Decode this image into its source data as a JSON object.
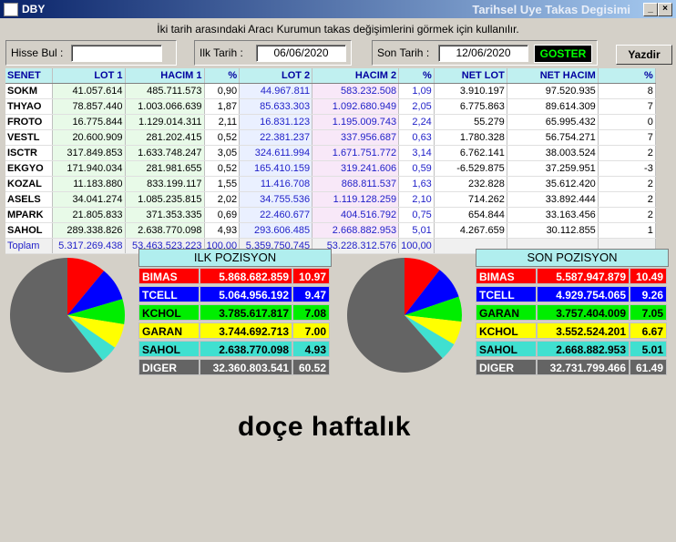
{
  "window": {
    "title": "DBY",
    "right_title": "Tarihsel Uye Takas Degisimi"
  },
  "hint": "İki tarih arasındaki  Aracı Kurumun takas değişimlerini görmek için kullanılır.",
  "form": {
    "hisse_label": "Hisse Bul :",
    "hisse_value": "",
    "ilk_label": "Ilk Tarih :",
    "ilk_value": "06/06/2020",
    "son_label": "Son Tarih :",
    "son_value": "12/06/2020",
    "goster": "GOSTER",
    "yazdir": "Yazdir"
  },
  "table": {
    "headers": [
      "SENET",
      "LOT 1",
      "HACIM 1",
      "%",
      "LOT 2",
      "HACIM 2",
      "%",
      "NET LOT",
      "NET HACIM",
      "%"
    ],
    "rows": [
      [
        "SOKM",
        "41.057.614",
        "485.711.573",
        "0,90",
        "44.967.811",
        "583.232.508",
        "1,09",
        "3.910.197",
        "97.520.935",
        "8"
      ],
      [
        "THYAO",
        "78.857.440",
        "1.003.066.639",
        "1,87",
        "85.633.303",
        "1.092.680.949",
        "2,05",
        "6.775.863",
        "89.614.309",
        "7"
      ],
      [
        "FROTO",
        "16.775.844",
        "1.129.014.311",
        "2,11",
        "16.831.123",
        "1.195.009.743",
        "2,24",
        "55.279",
        "65.995.432",
        "0"
      ],
      [
        "VESTL",
        "20.600.909",
        "281.202.415",
        "0,52",
        "22.381.237",
        "337.956.687",
        "0,63",
        "1.780.328",
        "56.754.271",
        "7"
      ],
      [
        "ISCTR",
        "317.849.853",
        "1.633.748.247",
        "3,05",
        "324.611.994",
        "1.671.751.772",
        "3,14",
        "6.762.141",
        "38.003.524",
        "2"
      ],
      [
        "EKGYO",
        "171.940.034",
        "281.981.655",
        "0,52",
        "165.410.159",
        "319.241.606",
        "0,59",
        "-6.529.875",
        "37.259.951",
        "-3"
      ],
      [
        "KOZAL",
        "11.183.880",
        "833.199.117",
        "1,55",
        "11.416.708",
        "868.811.537",
        "1,63",
        "232.828",
        "35.612.420",
        "2"
      ],
      [
        "ASELS",
        "34.041.274",
        "1.085.235.815",
        "2,02",
        "34.755.536",
        "1.119.128.259",
        "2,10",
        "714.262",
        "33.892.444",
        "2"
      ],
      [
        "MPARK",
        "21.805.833",
        "371.353.335",
        "0,69",
        "22.460.677",
        "404.516.792",
        "0,75",
        "654.844",
        "33.163.456",
        "2"
      ],
      [
        "SAHOL",
        "289.338.826",
        "2.638.770.098",
        "4,93",
        "293.606.485",
        "2.668.882.953",
        "5,01",
        "4.267.659",
        "30.112.855",
        "1"
      ]
    ],
    "total": [
      "Toplam",
      "5.317.269.438",
      "53.463.523.223",
      "100,00",
      "5.359.750.745",
      "53.228.312.576",
      "100,00",
      "",
      "",
      ""
    ]
  },
  "ilk_pozisyon": {
    "title": "ILK POZISYON",
    "rows": [
      {
        "name": "BIMAS",
        "value": "5.868.682.859",
        "pct": "10.97",
        "color": "#ff0000"
      },
      {
        "name": "TCELL",
        "value": "5.064.956.192",
        "pct": "9.47",
        "color": "#0000ff"
      },
      {
        "name": "KCHOL",
        "value": "3.785.617.817",
        "pct": "7.08",
        "color": "#00ee00"
      },
      {
        "name": "GARAN",
        "value": "3.744.692.713",
        "pct": "7.00",
        "color": "#ffff00"
      },
      {
        "name": "SAHOL",
        "value": "2.638.770.098",
        "pct": "4.93",
        "color": "#40e0d0"
      },
      {
        "name": "DIGER",
        "value": "32.360.803.541",
        "pct": "60.52",
        "color": "#646464"
      }
    ]
  },
  "son_pozisyon": {
    "title": "SON POZISYON",
    "rows": [
      {
        "name": "BIMAS",
        "value": "5.587.947.879",
        "pct": "10.49",
        "color": "#ff0000"
      },
      {
        "name": "TCELL",
        "value": "4.929.754.065",
        "pct": "9.26",
        "color": "#0000ff"
      },
      {
        "name": "GARAN",
        "value": "3.757.404.009",
        "pct": "7.05",
        "color": "#00ee00"
      },
      {
        "name": "KCHOL",
        "value": "3.552.524.201",
        "pct": "6.67",
        "color": "#ffff00"
      },
      {
        "name": "SAHOL",
        "value": "2.668.882.953",
        "pct": "5.01",
        "color": "#40e0d0"
      },
      {
        "name": "DIGER",
        "value": "32.731.799.466",
        "pct": "61.49",
        "color": "#646464"
      }
    ]
  },
  "caption": "doçe haftalık"
}
